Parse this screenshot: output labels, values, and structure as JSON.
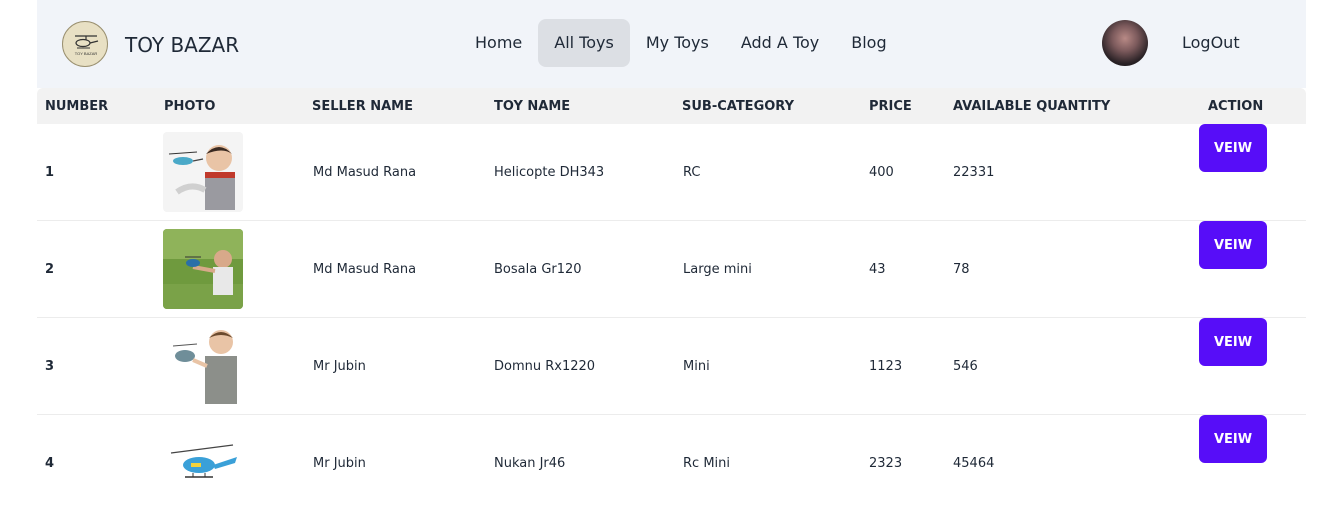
{
  "navbar": {
    "brand": "TOY BAZAR",
    "logo_text": "TOY BAZAR",
    "menu": [
      {
        "label": "Home",
        "active": false
      },
      {
        "label": "All Toys",
        "active": true
      },
      {
        "label": "My Toys",
        "active": false
      },
      {
        "label": "Add A Toy",
        "active": false
      },
      {
        "label": "Blog",
        "active": false
      }
    ],
    "logout_label": "LogOut"
  },
  "table": {
    "headers": [
      "NUMBER",
      "PHOTO",
      "SELLER NAME",
      "TOY NAME",
      "SUB-CATEGORY",
      "PRICE",
      "AVAILABLE QUANTITY",
      "ACTION"
    ],
    "rows": [
      {
        "number": "1",
        "seller": "Md Masud Rana",
        "toy": "Helicopte DH343",
        "subcategory": "RC",
        "price": "400",
        "quantity": "22331",
        "action": "VEIW"
      },
      {
        "number": "2",
        "seller": "Md Masud Rana",
        "toy": "Bosala Gr120",
        "subcategory": "Large mini",
        "price": "43",
        "quantity": "78",
        "action": "VEIW"
      },
      {
        "number": "3",
        "seller": "Mr Jubin",
        "toy": "Domnu Rx1220",
        "subcategory": "Mini",
        "price": "1123",
        "quantity": "546",
        "action": "VEIW"
      },
      {
        "number": "4",
        "seller": "Mr Jubin",
        "toy": "Nukan Jr46",
        "subcategory": "Rc Mini",
        "price": "2323",
        "quantity": "45464",
        "action": "VEIW"
      }
    ]
  },
  "colors": {
    "navbar_bg": "#f1f4f9",
    "active_menu_bg": "#dcdfe4",
    "button_bg": "#570df8",
    "header_bg": "#f2f2f2"
  }
}
